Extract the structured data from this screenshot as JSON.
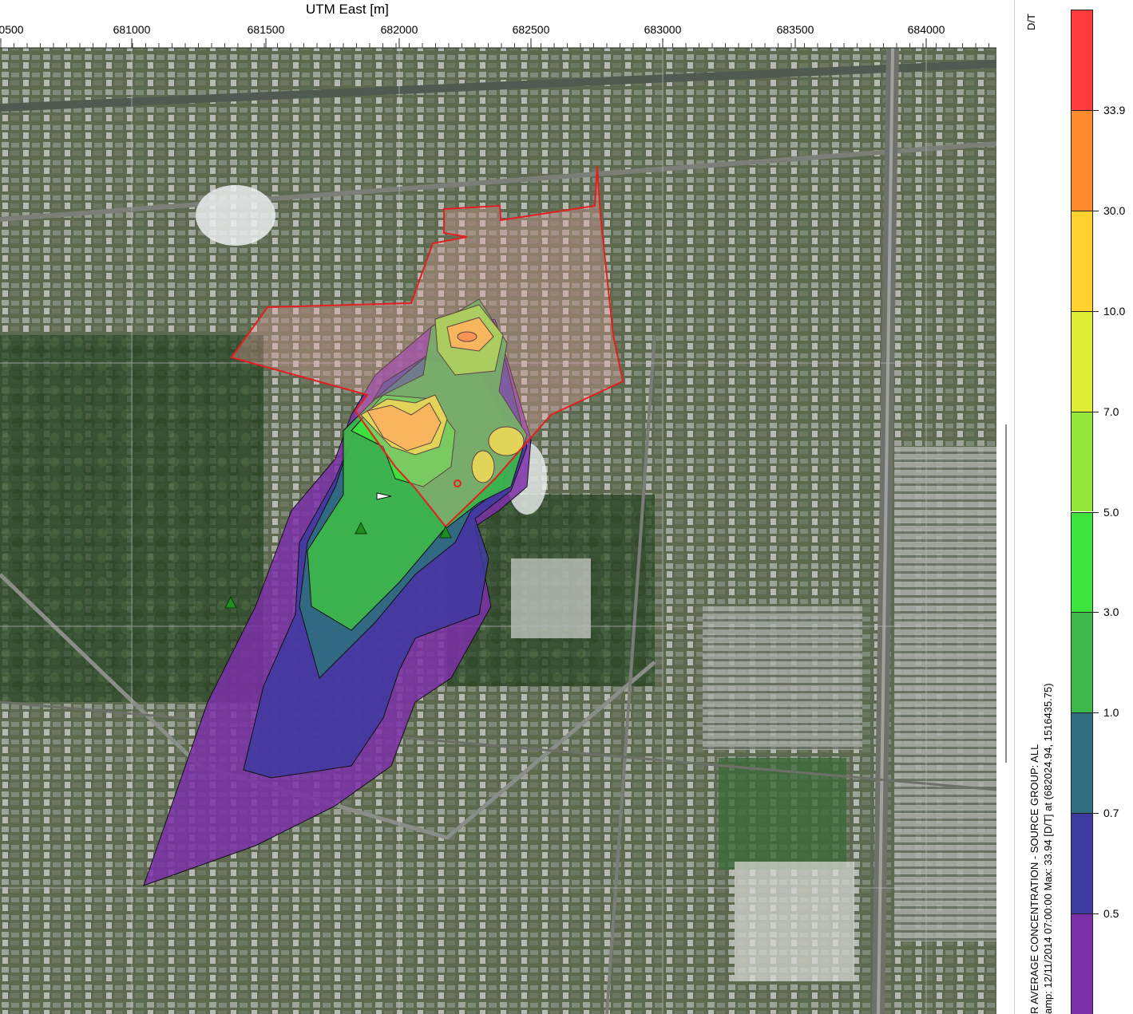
{
  "map": {
    "axis_title": "UTM East [m]",
    "x_ticks": [
      "0500",
      "681000",
      "681500",
      "682000",
      "682500",
      "683000",
      "683500",
      "684000"
    ],
    "basemap": "satellite-imagery",
    "plume_colors": [
      "#7b2fa8",
      "#3e3599",
      "#2f6f7f",
      "#3db84a",
      "#3ee43e",
      "#93e63a",
      "#dfee33",
      "#f6c131",
      "#f5822b"
    ],
    "property_boundary_color": "#e31f1f"
  },
  "legend": {
    "units": "D/T",
    "bins": [
      {
        "color": "#7b2fa8",
        "label": "0.5"
      },
      {
        "color": "#3d3aa0",
        "label": "0.7"
      },
      {
        "color": "#2f6f7f",
        "label": "1.0"
      },
      {
        "color": "#3db84a",
        "label": "3.0"
      },
      {
        "color": "#3ee43e",
        "label": "5.0"
      },
      {
        "color": "#93e63a",
        "label": "7.0"
      },
      {
        "color": "#dfee33",
        "label": "10.0"
      },
      {
        "color": "#ffd12f",
        "label": "30.0"
      },
      {
        "color": "#ff8c2c",
        "label": "33.9"
      },
      {
        "color": "#ff3b3b",
        "label": ""
      }
    ]
  },
  "info": {
    "line1": "R AVERAGE CONCENTRATION - SOURCE GROUP: ALL",
    "line2": "amp: 12/11/2014 07:00:00  Max: 33.94 [D/T]  at  (682024.94, 1516435.75)"
  }
}
